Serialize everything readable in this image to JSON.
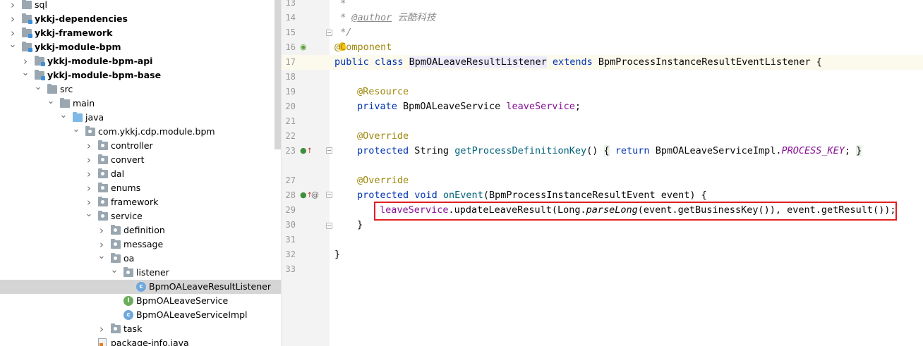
{
  "project_tree": {
    "items": [
      {
        "label": "sql",
        "depth": 0,
        "chevron": "collapsed",
        "icon": "folder",
        "bold": false
      },
      {
        "label": "ykkj-dependencies",
        "depth": 0,
        "chevron": "collapsed",
        "icon": "module-folder",
        "bold": true
      },
      {
        "label": "ykkj-framework",
        "depth": 0,
        "chevron": "collapsed",
        "icon": "module-folder",
        "bold": true
      },
      {
        "label": "ykkj-module-bpm",
        "depth": 0,
        "chevron": "expanded",
        "icon": "module-folder",
        "bold": true
      },
      {
        "label": "ykkj-module-bpm-api",
        "depth": 1,
        "chevron": "collapsed",
        "icon": "module-folder",
        "bold": true
      },
      {
        "label": "ykkj-module-bpm-base",
        "depth": 1,
        "chevron": "expanded",
        "icon": "module-folder",
        "bold": true
      },
      {
        "label": "src",
        "depth": 2,
        "chevron": "expanded",
        "icon": "folder",
        "bold": false
      },
      {
        "label": "main",
        "depth": 3,
        "chevron": "expanded",
        "icon": "folder",
        "bold": false
      },
      {
        "label": "java",
        "depth": 4,
        "chevron": "expanded",
        "icon": "java-folder",
        "bold": false
      },
      {
        "label": "com.ykkj.cdp.module.bpm",
        "depth": 5,
        "chevron": "expanded",
        "icon": "package-folder",
        "bold": false
      },
      {
        "label": "controller",
        "depth": 6,
        "chevron": "collapsed",
        "icon": "package-folder",
        "bold": false
      },
      {
        "label": "convert",
        "depth": 6,
        "chevron": "collapsed",
        "icon": "package-folder",
        "bold": false
      },
      {
        "label": "dal",
        "depth": 6,
        "chevron": "collapsed",
        "icon": "package-folder",
        "bold": false
      },
      {
        "label": "enums",
        "depth": 6,
        "chevron": "collapsed",
        "icon": "package-folder",
        "bold": false
      },
      {
        "label": "framework",
        "depth": 6,
        "chevron": "collapsed",
        "icon": "package-folder",
        "bold": false
      },
      {
        "label": "service",
        "depth": 6,
        "chevron": "expanded",
        "icon": "package-folder",
        "bold": false
      },
      {
        "label": "definition",
        "depth": 7,
        "chevron": "collapsed",
        "icon": "package-folder",
        "bold": false
      },
      {
        "label": "message",
        "depth": 7,
        "chevron": "collapsed",
        "icon": "package-folder",
        "bold": false
      },
      {
        "label": "oa",
        "depth": 7,
        "chevron": "expanded",
        "icon": "package-folder",
        "bold": false
      },
      {
        "label": "listener",
        "depth": 8,
        "chevron": "expanded",
        "icon": "package-folder",
        "bold": false
      },
      {
        "label": "BpmOALeaveResultListener",
        "depth": 9,
        "chevron": "none",
        "icon": "class-icon",
        "bold": false,
        "selected": true
      },
      {
        "label": "BpmOALeaveService",
        "depth": 8,
        "chevron": "none",
        "icon": "interface-icon",
        "bold": false
      },
      {
        "label": "BpmOALeaveServiceImpl",
        "depth": 8,
        "chevron": "none",
        "icon": "class-icon",
        "bold": false
      },
      {
        "label": "task",
        "depth": 7,
        "chevron": "collapsed",
        "icon": "package-folder",
        "bold": false
      },
      {
        "label": "package-info.java",
        "depth": 6,
        "chevron": "none",
        "icon": "java-file-icon",
        "bold": false
      }
    ]
  },
  "editor": {
    "line_numbers": [
      "13",
      "14",
      "15",
      "16",
      "17",
      "18",
      "19",
      "20",
      "21",
      "22",
      "23",
      "27",
      "28",
      "29",
      "30",
      "31",
      "32",
      "33"
    ],
    "current_line": "17",
    "lines": {
      "l13": " *",
      "l14_star": " * ",
      "l14_tag": "@author",
      "l14_text": " 云酷科技",
      "l15": " */",
      "l16_at": "@",
      "l16_rest": "Component",
      "l17_kw1": "public class ",
      "l17_cls": "BpmOALeaveResultListener",
      "l17_kw2": " extends ",
      "l17_rest": "BpmProcessInstanceResultEventListener {",
      "l19": "@Resource",
      "l20_kw": "private ",
      "l20_type": "BpmOALeaveService ",
      "l20_fld": "leaveService",
      "l20_end": ";",
      "l22": "@Override",
      "l23_kw": "protected ",
      "l23_type": "String ",
      "l23_fn": "getProcessDefinitionKey",
      "l23_paren": "() ",
      "l23_ob": "{",
      "l23_ret": " return ",
      "l23_cls": "BpmOALeaveServiceImpl.",
      "l23_const": "PROCESS_KEY",
      "l23_semi": "; ",
      "l23_cb": "}",
      "l27": "@Override",
      "l28_kw": "protected void ",
      "l28_fn": "onEvent",
      "l28_rest": "(BpmProcessInstanceResultEvent event) {",
      "l29_fld": "leaveService",
      "l29_a": ".updateLeaveResult(Long.",
      "l29_static": "parseLong",
      "l29_b": "(event.getBusinessKey()), event.getResult());",
      "l30": "}",
      "l32": "}"
    },
    "gutter_icons": {
      "l16": "spring-bean-icon",
      "l23": "override-implement-icon",
      "l28": "override-implement-icon",
      "l28_extra": "at-icon"
    },
    "highlight_box_color": "#e02020"
  }
}
